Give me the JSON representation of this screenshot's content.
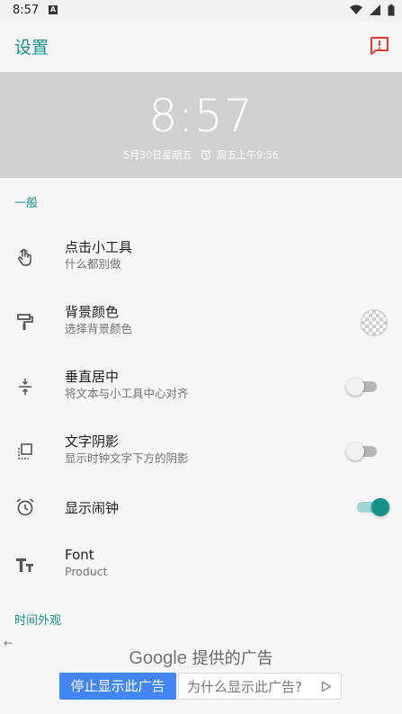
{
  "status_bar": {
    "time": "8:57",
    "notification_badge": "A"
  },
  "app_bar": {
    "title": "设置",
    "feedback_icon": "report-icon"
  },
  "preview": {
    "time": "8:57",
    "date": "5月30日星期五",
    "alarm_text": "周五上午9:56"
  },
  "sections": {
    "general": "一般",
    "time_appearance": "时间外观"
  },
  "prefs": {
    "tap": {
      "title": "点击小工具",
      "summary": "什么都别做",
      "icon": "touch-icon"
    },
    "background": {
      "title": "背景颜色",
      "summary": "选择背景颜色",
      "icon": "paint-roller-icon"
    },
    "center": {
      "title": "垂直居中",
      "summary": "将文本与小工具中心对齐",
      "icon": "vertical-align-center-icon",
      "enabled": false
    },
    "shadow": {
      "title": "文字阴影",
      "summary": "显示时钟文字下方的阴影",
      "icon": "shadow-icon",
      "enabled": false
    },
    "alarm": {
      "title": "显示闹钟",
      "icon": "alarm-clock-icon",
      "enabled": true
    },
    "font": {
      "title": "Font",
      "summary": "Product",
      "icon": "text-fields-icon"
    }
  },
  "ad": {
    "google_word": "Google",
    "provided": "提供的广告",
    "stop_label": "停止显示此广告",
    "why_label": "为什么显示此广告?"
  },
  "colors": {
    "accent": "#14928a",
    "preview_bg": "#d1d1d1",
    "ad_blue": "#4285f4"
  }
}
